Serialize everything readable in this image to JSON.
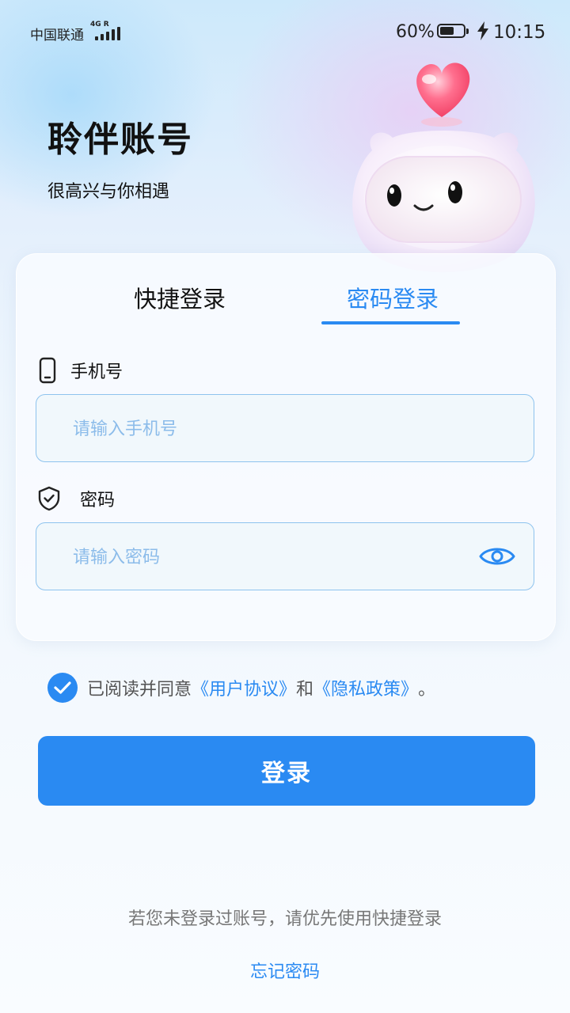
{
  "status_bar": {
    "carrier": "中国联通",
    "network": "4G R",
    "battery_percent": "60%",
    "battery_level": 0.6,
    "time": "10:15"
  },
  "header": {
    "title": "聆伴账号",
    "subtitle": "很高兴与你相遇"
  },
  "tabs": [
    {
      "label": "快捷登录",
      "active": false
    },
    {
      "label": "密码登录",
      "active": true
    }
  ],
  "form": {
    "phone": {
      "label": "手机号",
      "placeholder": "请输入手机号",
      "value": ""
    },
    "password": {
      "label": "密码",
      "placeholder": "请输入密码",
      "value": ""
    }
  },
  "agreement": {
    "checked": true,
    "prefix": "已阅读并同意",
    "user_agreement": "《用户协议》",
    "and": "和",
    "privacy_policy": "《隐私政策》",
    "suffix": "。"
  },
  "login_button": "登录",
  "hint": "若您未登录过账号，请优先使用快捷登录",
  "forgot_password": "忘记密码",
  "colors": {
    "accent": "#2a8af2",
    "text_primary": "#111111",
    "placeholder": "#8cbcea"
  }
}
